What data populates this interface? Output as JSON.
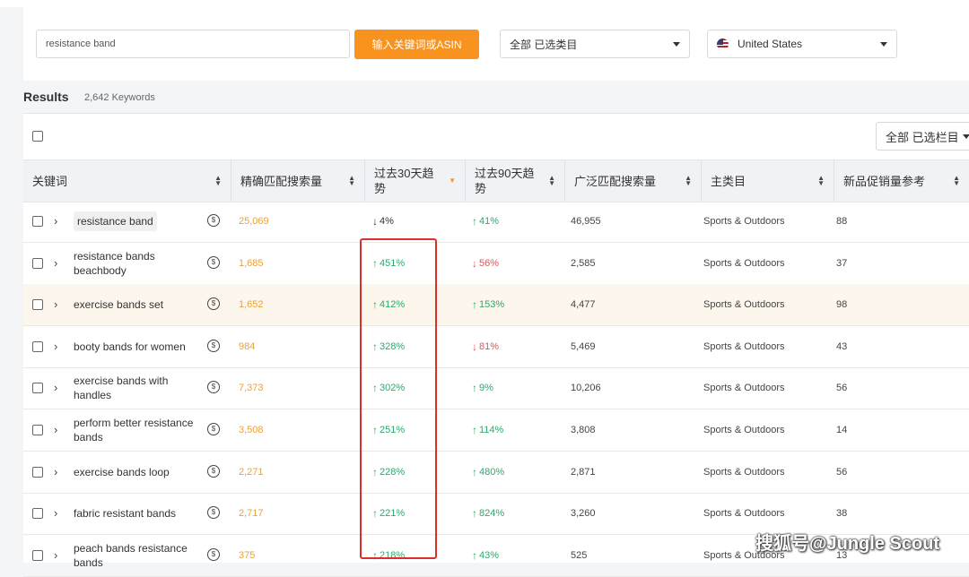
{
  "search": {
    "value": "resistance band",
    "button_label": "输入关键词或ASIN"
  },
  "category_select": {
    "value": "全部 已选类目"
  },
  "country_select": {
    "value": "United States"
  },
  "results": {
    "title": "Results",
    "count": "2,642 Keywords"
  },
  "column_select": {
    "value": "全部 已选栏目"
  },
  "columns": [
    "关键词",
    "精确匹配搜索量",
    "过去30天趋势",
    "过去90天趋势",
    "广泛匹配搜索量",
    "主类目",
    "新品促销量参考"
  ],
  "rows": [
    {
      "keyword": "resistance band",
      "exact": "25,069",
      "t30": "4%",
      "t30_dir": "down-neutral",
      "t90": "41%",
      "t90_dir": "up",
      "broad": "46,955",
      "category": "Sports & Outdoors",
      "promo": "88"
    },
    {
      "keyword": "resistance bands beachbody",
      "exact": "1,685",
      "t30": "451%",
      "t30_dir": "up",
      "t90": "56%",
      "t90_dir": "down",
      "broad": "2,585",
      "category": "Sports & Outdoors",
      "promo": "37"
    },
    {
      "keyword": "exercise bands set",
      "exact": "1,652",
      "t30": "412%",
      "t30_dir": "up",
      "t90": "153%",
      "t90_dir": "up",
      "broad": "4,477",
      "category": "Sports & Outdoors",
      "promo": "98"
    },
    {
      "keyword": "booty bands for women",
      "exact": "984",
      "t30": "328%",
      "t30_dir": "up",
      "t90": "81%",
      "t90_dir": "down",
      "broad": "5,469",
      "category": "Sports & Outdoors",
      "promo": "43"
    },
    {
      "keyword": "exercise bands with handles",
      "exact": "7,373",
      "t30": "302%",
      "t30_dir": "up",
      "t90": "9%",
      "t90_dir": "up",
      "broad": "10,206",
      "category": "Sports & Outdoors",
      "promo": "56"
    },
    {
      "keyword": "perform better resistance bands",
      "exact": "3,508",
      "t30": "251%",
      "t30_dir": "up",
      "t90": "114%",
      "t90_dir": "up",
      "broad": "3,808",
      "category": "Sports & Outdoors",
      "promo": "14"
    },
    {
      "keyword": "exercise bands loop",
      "exact": "2,271",
      "t30": "228%",
      "t30_dir": "up",
      "t90": "480%",
      "t90_dir": "up",
      "broad": "2,871",
      "category": "Sports & Outdoors",
      "promo": "56"
    },
    {
      "keyword": "fabric resistant bands",
      "exact": "2,717",
      "t30": "221%",
      "t30_dir": "up",
      "t90": "824%",
      "t90_dir": "up",
      "broad": "3,260",
      "category": "Sports & Outdoors",
      "promo": "38"
    },
    {
      "keyword": "peach bands resistance bands",
      "exact": "375",
      "t30": "218%",
      "t30_dir": "up",
      "t90": "43%",
      "t90_dir": "up",
      "broad": "525",
      "category": "Sports & Outdoors",
      "promo": "13"
    }
  ],
  "watermark": "搜狐号@Jungle Scout",
  "colors": {
    "accent": "#f7931e",
    "up": "#2ea86d",
    "down": "#e2525b",
    "highlight_box": "#d9302c"
  }
}
